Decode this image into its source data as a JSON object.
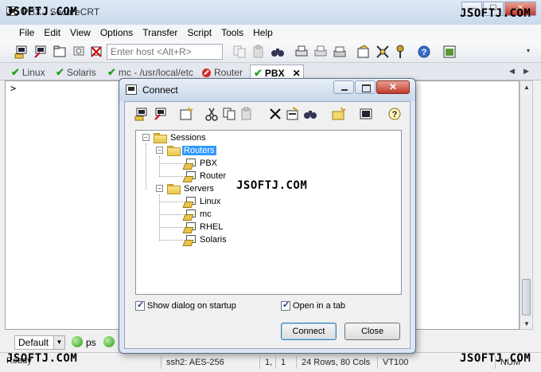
{
  "window": {
    "title": "PBX - SecureCRT",
    "min_glyph": "—",
    "max_glyph": "☐",
    "close_glyph": "✕"
  },
  "watermark": "JSOFTJ.COM",
  "menu": [
    "File",
    "Edit",
    "View",
    "Options",
    "Transfer",
    "Script",
    "Tools",
    "Help"
  ],
  "toolbar": {
    "host_placeholder": "Enter host <Alt+R>"
  },
  "tabs": [
    {
      "label": "Linux",
      "status": "connected"
    },
    {
      "label": "Solaris",
      "status": "connected"
    },
    {
      "label": "mc - /usr/local/etc",
      "status": "connected"
    },
    {
      "label": "Router",
      "status": "disconnected"
    },
    {
      "label": "PBX",
      "status": "connected",
      "active": true,
      "close": "✕"
    }
  ],
  "tab_nav": {
    "prev": "◀",
    "next": "▶"
  },
  "terminal": {
    "prompt": ">"
  },
  "button_bar": {
    "combo_value": "Default",
    "combo_arrow": "▼",
    "buttons": [
      "ps"
    ]
  },
  "status": {
    "ready": "Ready",
    "protocol": "ssh2: AES-256",
    "row": "1,",
    "col": "1",
    "size": "24 Rows, 80 Cols",
    "term": "VT100",
    "num": "NUM"
  },
  "dialog": {
    "title": "Connect",
    "close_glyph": "✕",
    "tree": {
      "root": "Sessions",
      "folders": [
        {
          "name": "Routers",
          "sessions": [
            "PBX",
            "Router"
          ]
        },
        {
          "name": "Servers",
          "sessions": [
            "Linux",
            "mc",
            "RHEL",
            "Solaris"
          ]
        }
      ]
    },
    "show_dialog_on_startup": "Show dialog on startup",
    "open_in_tab": "Open in a tab",
    "connect": "Connect",
    "close": "Close",
    "expanded_glyph": "−"
  }
}
